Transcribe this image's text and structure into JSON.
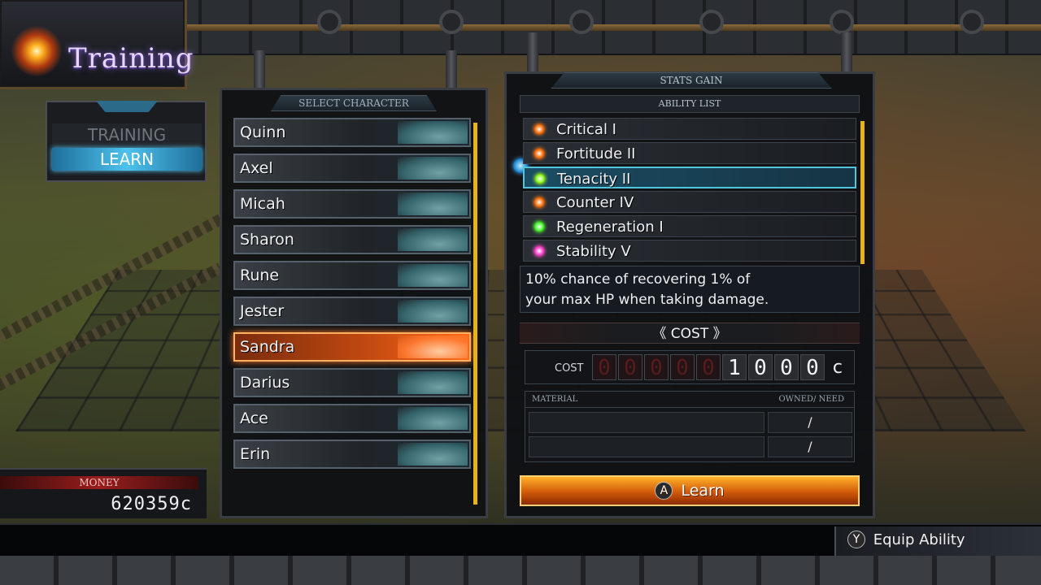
{
  "title": "Training",
  "mode_menu": {
    "items": [
      {
        "label": "TRAINING",
        "active": false
      },
      {
        "label": "LEARN",
        "active": true
      }
    ]
  },
  "money": {
    "label": "MONEY",
    "value": "620359c"
  },
  "select_character": {
    "header": "SELECT CHARACTER",
    "characters": [
      {
        "name": "Quinn",
        "selected": false
      },
      {
        "name": "Axel",
        "selected": false
      },
      {
        "name": "Micah",
        "selected": false
      },
      {
        "name": "Sharon",
        "selected": false
      },
      {
        "name": "Rune",
        "selected": false
      },
      {
        "name": "Jester",
        "selected": false
      },
      {
        "name": "Sandra",
        "selected": true
      },
      {
        "name": "Darius",
        "selected": false
      },
      {
        "name": "Ace",
        "selected": false
      },
      {
        "name": "Erin",
        "selected": false
      }
    ]
  },
  "stats_gain": {
    "header": "STATS GAIN",
    "ability_list_header": "ABILITY LIST",
    "abilities": [
      {
        "name": "Critical I",
        "icon_color": "#ff7a1a",
        "selected": false
      },
      {
        "name": "Fortitude II",
        "icon_color": "#ff7a1a",
        "selected": false
      },
      {
        "name": "Tenacity II",
        "icon_color": "#8dff2a",
        "selected": true
      },
      {
        "name": "Counter IV",
        "icon_color": "#ff7a1a",
        "selected": false
      },
      {
        "name": "Regeneration I",
        "icon_color": "#4cff3a",
        "selected": false
      },
      {
        "name": "Stability V",
        "icon_color": "#ff4ad6",
        "selected": false
      }
    ],
    "description_line1": "10% chance of recovering 1% of",
    "description_line2": "your max HP when taking damage.",
    "cost_title": "《 COST 》",
    "cost_label": "COST",
    "cost_digits": [
      "0",
      "0",
      "0",
      "0",
      "0",
      "1",
      "0",
      "0",
      "0"
    ],
    "cost_unit": "c",
    "material_header": "MATERIAL",
    "owned_need_header": "OWNED/  NEED",
    "materials": [
      {
        "name": "",
        "owned_need": "/"
      },
      {
        "name": "",
        "owned_need": "/"
      }
    ],
    "learn_button_glyph": "A",
    "learn_button_label": "Learn"
  },
  "footer": {
    "equip_glyph": "Y",
    "equip_label": "Equip Ability"
  }
}
